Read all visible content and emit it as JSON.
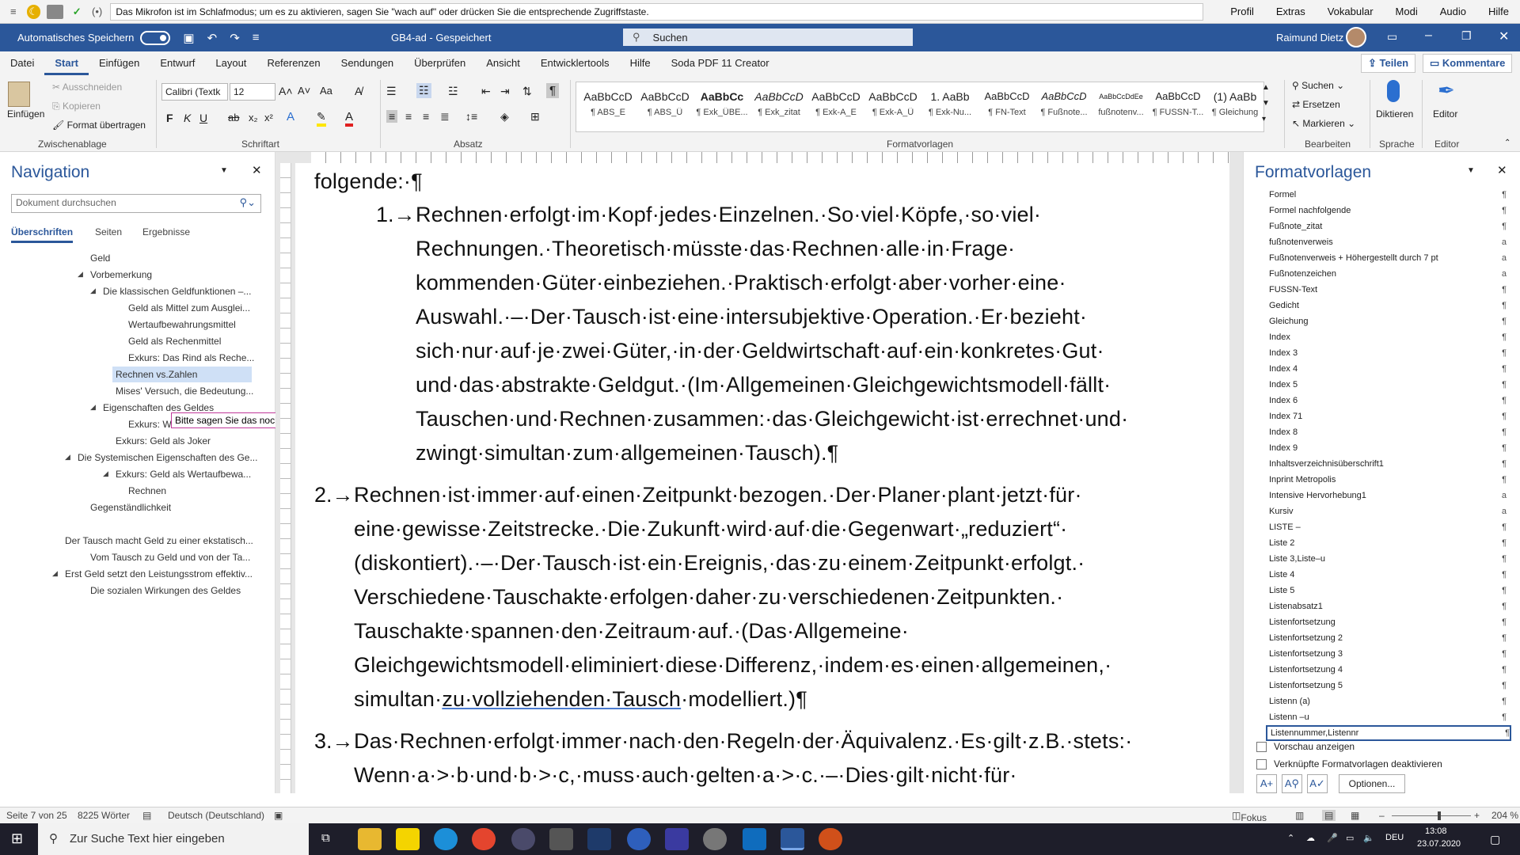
{
  "speech_bar": {
    "message": "Das Mikrofon ist im Schlafmodus; um es zu aktivieren, sagen Sie \"wach auf\" oder drücken Sie die entsprechende Zugriffstaste.",
    "menu": [
      "Profil",
      "Extras",
      "Vokabular",
      "Modi",
      "Audio",
      "Hilfe"
    ]
  },
  "title_bar": {
    "autosave": "Automatisches Speichern",
    "doc_name": "GB4-ad  -  Gespeichert",
    "search_placeholder": "Suchen",
    "user": "Raimund Dietz"
  },
  "tabs": [
    "Datei",
    "Start",
    "Einfügen",
    "Entwurf",
    "Layout",
    "Referenzen",
    "Sendungen",
    "Überprüfen",
    "Ansicht",
    "Entwicklertools",
    "Hilfe",
    "Soda PDF 11 Creator"
  ],
  "share": {
    "teilen": "Teilen",
    "kommentare": "Kommentare"
  },
  "ribbon": {
    "clipboard": {
      "paste": "Einfügen",
      "cut": "Ausschneiden",
      "copy": "Kopieren",
      "format_painter": "Format übertragen",
      "label": "Zwischenablage"
    },
    "font": {
      "name": "Calibri (Textk",
      "size": "12",
      "label": "Schriftart"
    },
    "paragraph_label": "Absatz",
    "styles_label": "Formatvorlagen",
    "styles": [
      {
        "preview": "AaBbCcD",
        "name": "¶ ABS_E"
      },
      {
        "preview": "AaBbCcD",
        "name": "¶ ABS_Ü"
      },
      {
        "preview": "AaBbCc",
        "name": "¶ Exk_ÜBE..."
      },
      {
        "preview": "AaBbCcD",
        "name": "¶ Exk_zitat"
      },
      {
        "preview": "AaBbCcD",
        "name": "¶ Exk-A_E"
      },
      {
        "preview": "AaBbCcD",
        "name": "¶ Exk-A_Ü"
      },
      {
        "preview": "1. AaBb",
        "name": "¶ Exk-Nu..."
      },
      {
        "preview": "AaBbCcD",
        "name": "¶ FN-Text"
      },
      {
        "preview": "AaBbCcD",
        "name": "¶ Fußnote..."
      },
      {
        "preview": "AaBbCcDdEe",
        "name": "fußnotenv..."
      },
      {
        "preview": "AaBbCcD",
        "name": "¶ FUSSN-T..."
      },
      {
        "preview": "(1) AaBb",
        "name": "¶ Gleichung"
      }
    ],
    "editing": {
      "find": "Suchen",
      "replace": "Ersetzen",
      "select": "Markieren",
      "label": "Bearbeiten"
    },
    "voice": {
      "dictate": "Diktieren",
      "label": "Sprache"
    },
    "editor": {
      "editor": "Editor",
      "label": "Editor"
    }
  },
  "navigation": {
    "title": "Navigation",
    "search_placeholder": "Dokument durchsuchen",
    "tabs": [
      "Überschriften",
      "Seiten",
      "Ergebnisse"
    ],
    "items": [
      "Geld",
      "Vorbemerkung",
      "Die klassischen Geldfunktionen –...",
      "Geld als Mittel zum Ausglei...",
      "Wertaufbewahrungsmittel",
      "Geld als Rechenmittel",
      "Exkurs: Das Rind als Reche...",
      "Rechnen vs.Zahlen",
      "Mises' Versuch, die Bedeutung...",
      "Eigenschaften des Geldes",
      "Exkurs: W",
      "Exkurs: Geld als Joker",
      "Die Systemischen Eigenschaften des Ge...",
      "Exkurs: Geld als Wertaufbewa...",
      "Rechnen",
      "Gegenständlichkeit",
      "Der Tausch macht Geld zu einer ekstatisch...",
      "Vom Tausch zu Geld und von der Ta...",
      "Erst Geld setzt den Leistungsstrom effektiv...",
      "Die sozialen Wirkungen des Geldes"
    ],
    "tooltip": "Bitte sagen Sie das noch einmal"
  },
  "document": {
    "lines": [
      "folgende:·¶",
      "Rechnen·erfolgt·im·Kopf·jedes·Einzelnen.·So·viel·Köpfe,·so·viel·",
      "Rechnungen.·Theoretisch·müsste·das·Rechnen·alle·in·Frage·",
      "kommenden·Güter·einbeziehen.·Praktisch·erfolgt·aber·vorher·eine·",
      "Auswahl.·–·Der·Tausch·ist·eine·intersubjektive·Operation.·Er·bezieht·",
      "sich·nur·auf·je·zwei·Güter,·in·der·Geldwirtschaft·auf·ein·konkretes·Gut·",
      "und·das·abstrakte·Geldgut.·(Im·Allgemeinen·Gleichgewichtsmodell·fällt·",
      "Tauschen·und·Rechnen·zusammen:·das·Gleichgewicht·ist·errechnet·und·",
      "zwingt·simultan·zum·allgemeinen·Tausch).¶",
      "Rechnen·ist·immer·auf·einen·Zeitpunkt·bezogen.·Der·Planer·plant·jetzt·für·",
      "eine·gewisse·Zeitstrecke.·Die·Zukunft·wird·auf·die·Gegenwart·„reduziert“·",
      "(diskontiert).·–·Der·Tausch·ist·ein·Ereignis,·das·zu·einem·Zeitpunkt·erfolgt.·",
      "Verschiedene·Tauschakte·erfolgen·daher·zu·verschiedenen·Zeitpunkten.·",
      "Tauschakte·spannen·den·Zeitraum·auf.·(Das·Allgemeine·",
      "Gleichgewichtsmodell·eliminiert·diese·Differenz,·indem·es·einen·allgemeinen,·",
      "simultan·",
      "zu·vollziehenden·Tausch",
      "·modelliert.)¶",
      "Das·Rechnen·erfolgt·immer·nach·den·Regeln·der·Äquivalenz.·Es·gilt·z.B.·stets:·",
      "Wenn·a·>·b·und·b·>·c,·muss·auch·gelten·a·>·c.·–·Dies·gilt·nicht·für·"
    ],
    "numbers": [
      "1.→",
      "2.→",
      "3.→"
    ]
  },
  "styles_pane": {
    "title": "Formatvorlagen",
    "items": [
      {
        "name": "Formel",
        "mark": "¶"
      },
      {
        "name": "Formel nachfolgende",
        "mark": "¶"
      },
      {
        "name": "Fußnote_zitat",
        "mark": "¶"
      },
      {
        "name": "fußnotenverweis",
        "mark": "a"
      },
      {
        "name": "Fußnotenverweis + Höhergestellt durch  7 pt",
        "mark": "a"
      },
      {
        "name": "Fußnotenzeichen",
        "mark": "a"
      },
      {
        "name": "FUSSN-Text",
        "mark": "¶"
      },
      {
        "name": "Gedicht",
        "mark": "¶"
      },
      {
        "name": "Gleichung",
        "mark": "¶"
      },
      {
        "name": "Index",
        "mark": "¶"
      },
      {
        "name": "Index 3",
        "mark": "¶"
      },
      {
        "name": "Index 4",
        "mark": "¶"
      },
      {
        "name": "Index 5",
        "mark": "¶"
      },
      {
        "name": "Index 6",
        "mark": "¶"
      },
      {
        "name": "Index 71",
        "mark": "¶"
      },
      {
        "name": "Index 8",
        "mark": "¶"
      },
      {
        "name": "Index 9",
        "mark": "¶"
      },
      {
        "name": "Inhaltsverzeichnisüberschrift1",
        "mark": "¶"
      },
      {
        "name": "Inprint Metropolis",
        "mark": "¶"
      },
      {
        "name": "Intensive Hervorhebung1",
        "mark": "a"
      },
      {
        "name": "Kursiv",
        "mark": "a"
      },
      {
        "name": "LISTE –",
        "mark": "¶"
      },
      {
        "name": "Liste 2",
        "mark": "¶"
      },
      {
        "name": "Liste 3,Liste–u",
        "mark": "¶"
      },
      {
        "name": "Liste 4",
        "mark": "¶"
      },
      {
        "name": "Liste 5",
        "mark": "¶"
      },
      {
        "name": "Listenabsatz1",
        "mark": "¶"
      },
      {
        "name": "Listenfortsetzung",
        "mark": "¶"
      },
      {
        "name": "Listenfortsetzung 2",
        "mark": "¶"
      },
      {
        "name": "Listenfortsetzung 3",
        "mark": "¶"
      },
      {
        "name": "Listenfortsetzung 4",
        "mark": "¶"
      },
      {
        "name": "Listenfortsetzung 5",
        "mark": "¶"
      },
      {
        "name": "Listenn (a)",
        "mark": "¶"
      },
      {
        "name": "Listenn –u",
        "mark": "¶"
      },
      {
        "name": "Listennummer,Listennr",
        "mark": "¶"
      }
    ],
    "preview_label": "Vorschau anzeigen",
    "linked_label": "Verknüpfte Formatvorlagen deaktivieren",
    "options_button": "Optionen..."
  },
  "status_bar": {
    "page": "Seite 7 von 25",
    "words": "8225 Wörter",
    "language": "Deutsch (Deutschland)",
    "focus": "Fokus",
    "zoom": "204 %"
  },
  "taskbar": {
    "search_placeholder": "Zur Suche Text hier eingeben",
    "language": "DEU",
    "time": "13:08",
    "date": "23.07.2020"
  }
}
